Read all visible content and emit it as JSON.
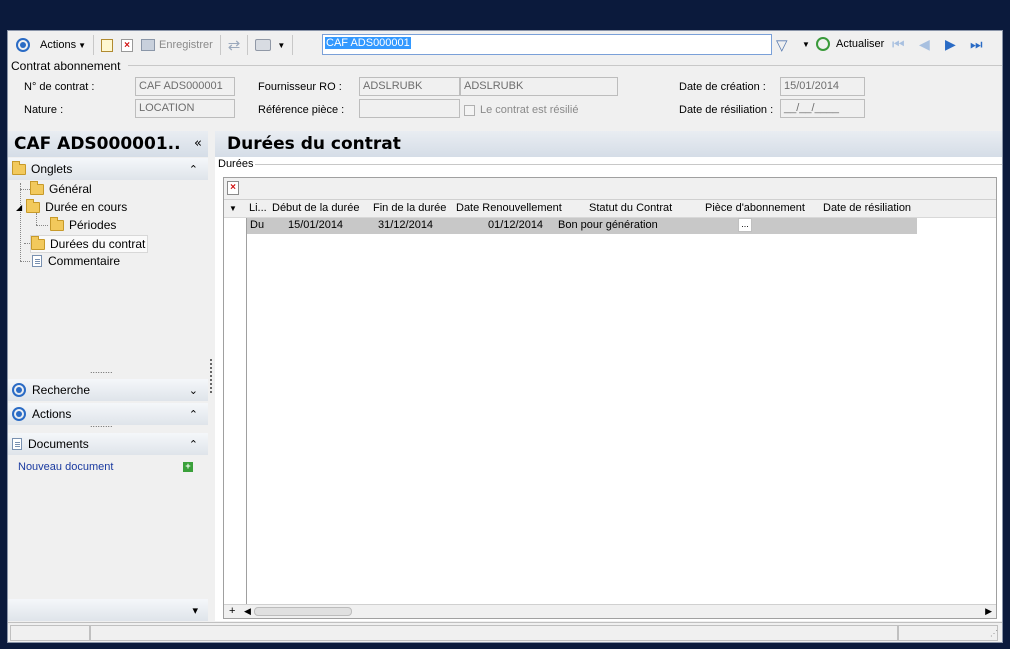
{
  "toolbar": {
    "actions_label": "Actions",
    "save_label": "Enregistrer",
    "search_value": "CAF ADS000001",
    "refresh_label": "Actualiser"
  },
  "form": {
    "group_label": "Contrat abonnement",
    "contract_no_label": "N° de contrat :",
    "contract_no_value": "CAF ADS000001",
    "nature_label": "Nature :",
    "nature_value": "LOCATION",
    "supplier_label": "Fournisseur RO :",
    "supplier_code": "ADSLRUBK",
    "supplier_name": "ADSLRUBK",
    "ref_label": "Référence pièce :",
    "ref_value": "",
    "terminated_label": "Le contrat  est résilié",
    "created_label": "Date de création :",
    "created_value": "15/01/2014",
    "terminated_date_label": "Date de résiliation :",
    "terminated_date_value": "__/__/____"
  },
  "left": {
    "title": "CAF ADS000001..",
    "collapse_glyph": "«",
    "onglets_label": "Onglets",
    "tree": [
      {
        "label": "Général"
      },
      {
        "label": "Durée en cours"
      },
      {
        "label": "Périodes"
      },
      {
        "label": "Durées du contrat"
      },
      {
        "label": "Commentaire"
      }
    ],
    "recherche_label": "Recherche",
    "actions_label": "Actions",
    "documents_label": "Documents",
    "new_doc_label": "Nouveau document"
  },
  "right": {
    "title": "Durées du contrat",
    "group_label": "Durées",
    "columns": [
      "Li...",
      "Début de la durée",
      "Fin de la durée",
      "Date Renouvellement",
      "Statut du Contrat",
      "Pièce d'abonnement",
      "Date de résiliation"
    ],
    "rows": [
      {
        "li": "Du",
        "start": "15/01/2014",
        "end": "31/12/2014",
        "renewal": "01/12/2014",
        "status": "Bon pour génération",
        "piece": "...",
        "termination": ""
      }
    ]
  }
}
